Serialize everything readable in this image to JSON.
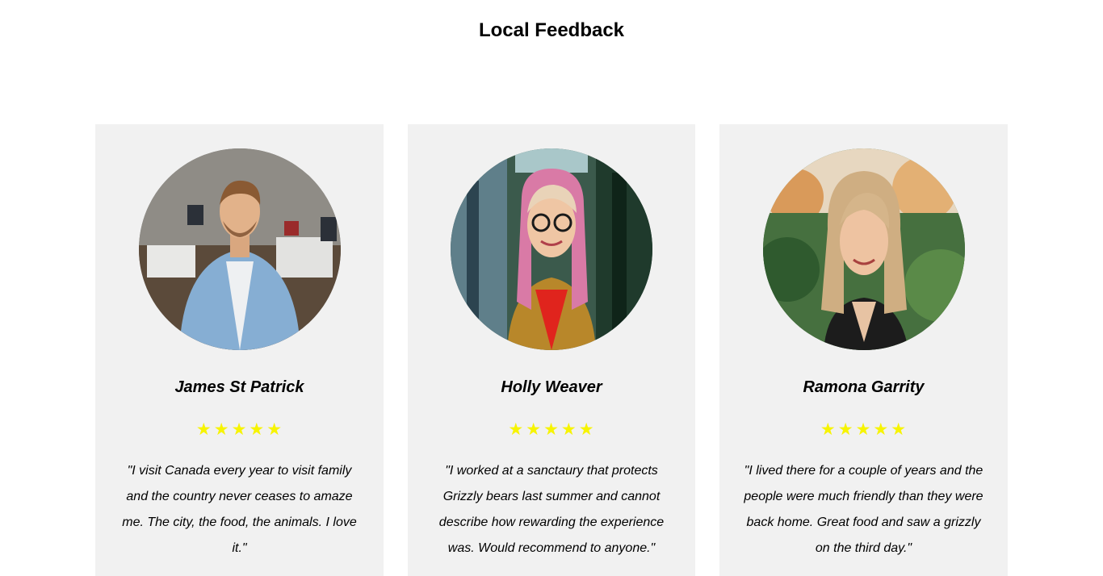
{
  "page": {
    "title": "Local Feedback"
  },
  "colors": {
    "card_background": "#f1f1f1",
    "star": "#f7f400"
  },
  "testimonials": [
    {
      "name": "James St Patrick",
      "rating": 5,
      "photo_icon": "man-in-office-photo",
      "quote": "\"I visit Canada every year to visit family and the country never ceases to amaze me. The city, the food, the animals. I love it.\""
    },
    {
      "name": "Holly Weaver",
      "rating": 5,
      "photo_icon": "woman-with-glasses-photo",
      "quote": "\"I worked at a sanctaury that protects Grizzly bears last summer and cannot describe how rewarding the experience was. Would recommend to anyone.\""
    },
    {
      "name": "Ramona Garrity",
      "rating": 5,
      "photo_icon": "woman-outdoors-photo",
      "quote": "\"I lived there for a couple of years and the people were much friendly than they were back home. Great food and saw a grizzly on the third day.\""
    }
  ]
}
